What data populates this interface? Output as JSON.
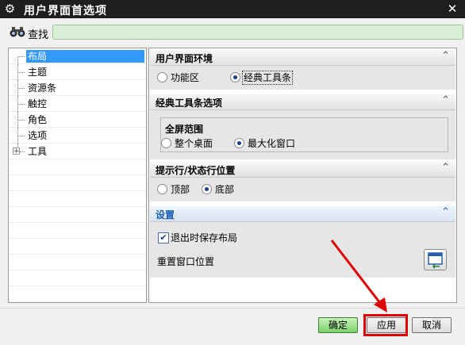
{
  "window": {
    "title": "用户界面首选项",
    "close_glyph": "✕",
    "sys_icon": "gear-icon"
  },
  "search": {
    "label": "查找",
    "value": "",
    "icon": "binoculars-icon"
  },
  "tree": {
    "items": [
      {
        "label": "布局",
        "selected": true
      },
      {
        "label": "主题"
      },
      {
        "label": "资源条"
      },
      {
        "label": "触控"
      },
      {
        "label": "角色"
      },
      {
        "label": "选项"
      },
      {
        "label": "工具",
        "expander": "+"
      }
    ]
  },
  "sections": {
    "env": {
      "title": "用户界面环境",
      "arrow": "⌃",
      "options": [
        "功能区",
        "经典工具条"
      ],
      "selected": 1
    },
    "classic": {
      "title": "经典工具条选项",
      "arrow": "⌃",
      "group_title": "全屏范围",
      "options": [
        "整个桌面",
        "最大化窗口"
      ],
      "selected": 1
    },
    "prompt": {
      "title": "提示行/状态行位置",
      "arrow": "⌃",
      "options": [
        "顶部",
        "底部"
      ],
      "selected": 1
    },
    "settings": {
      "title": "设置",
      "arrow": "⌃",
      "checkbox_label": "退出时保存布局",
      "checked": true,
      "reset_label": "重置窗口位置",
      "reset_icon": "window-reset-icon"
    }
  },
  "buttons": {
    "ok": "确定",
    "apply": "应用",
    "cancel": "取消"
  },
  "colors": {
    "accent_selected": "#3399ff",
    "ok_green": "#7bd16a",
    "highlight": "#e00000",
    "search_bg": "#d9efd6"
  }
}
